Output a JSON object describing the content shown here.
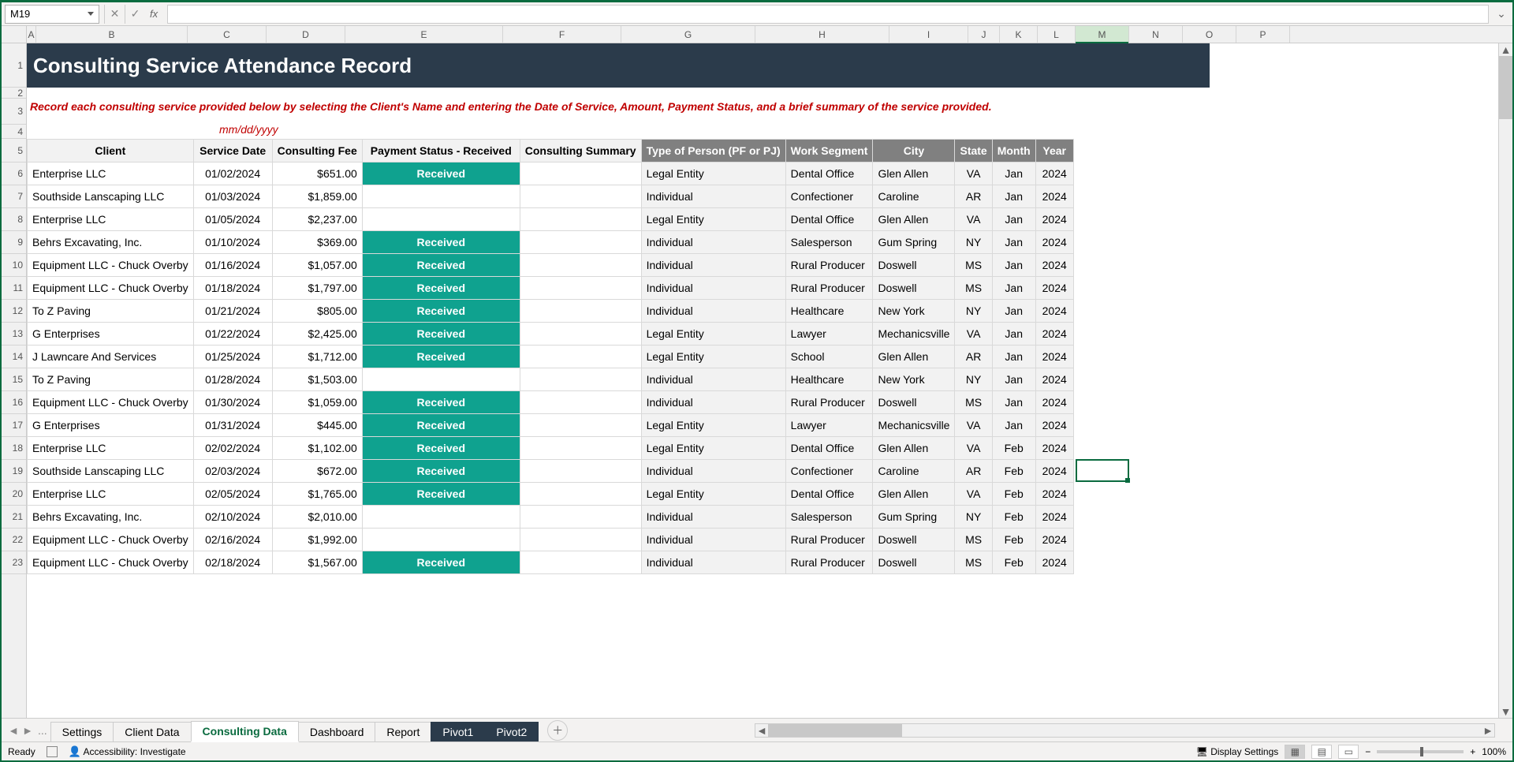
{
  "name_box": "M19",
  "fx_label": "fx",
  "title": "Consulting Service Attendance Record",
  "instruction": "Record each consulting service provided below by selecting the Client's Name and entering the Date of Service, Amount, Payment Status, and a brief summary of the service provided.",
  "date_format_hint": "mm/dd/yyyy",
  "columns": {
    "letters": [
      "A",
      "B",
      "C",
      "D",
      "E",
      "F",
      "G",
      "H",
      "I",
      "J",
      "K",
      "L",
      "M",
      "N",
      "O",
      "P"
    ],
    "active": "M"
  },
  "row_headers": [
    1,
    2,
    3,
    4,
    5,
    6,
    7,
    8,
    9,
    10,
    11,
    12,
    13,
    14,
    15,
    16,
    17,
    18,
    19,
    20,
    21,
    22,
    23
  ],
  "headers": {
    "client": "Client",
    "service_date": "Service Date",
    "fee": "Consulting Fee",
    "payment": "Payment Status - Received",
    "summary": "Consulting Summary",
    "type": "Type of Person (PF or PJ)",
    "segment": "Work Segment",
    "city": "City",
    "state": "State",
    "month": "Month",
    "year": "Year"
  },
  "rows": [
    {
      "client": "Enterprise LLC",
      "date": "01/02/2024",
      "fee": "$651.00",
      "received": true,
      "type": "Legal Entity",
      "segment": "Dental Office",
      "city": "Glen Allen",
      "state": "VA",
      "month": "Jan",
      "year": "2024"
    },
    {
      "client": "Southside Lanscaping LLC",
      "date": "01/03/2024",
      "fee": "$1,859.00",
      "received": false,
      "type": "Individual",
      "segment": "Confectioner",
      "city": "Caroline",
      "state": "AR",
      "month": "Jan",
      "year": "2024"
    },
    {
      "client": "Enterprise LLC",
      "date": "01/05/2024",
      "fee": "$2,237.00",
      "received": false,
      "type": "Legal Entity",
      "segment": "Dental Office",
      "city": "Glen Allen",
      "state": "VA",
      "month": "Jan",
      "year": "2024"
    },
    {
      "client": "Behrs Excavating, Inc.",
      "date": "01/10/2024",
      "fee": "$369.00",
      "received": true,
      "type": "Individual",
      "segment": "Salesperson",
      "city": "Gum Spring",
      "state": "NY",
      "month": "Jan",
      "year": "2024"
    },
    {
      "client": "Equipment LLC - Chuck Overby",
      "date": "01/16/2024",
      "fee": "$1,057.00",
      "received": true,
      "type": "Individual",
      "segment": "Rural Producer",
      "city": "Doswell",
      "state": "MS",
      "month": "Jan",
      "year": "2024"
    },
    {
      "client": "Equipment LLC - Chuck Overby",
      "date": "01/18/2024",
      "fee": "$1,797.00",
      "received": true,
      "type": "Individual",
      "segment": "Rural Producer",
      "city": "Doswell",
      "state": "MS",
      "month": "Jan",
      "year": "2024"
    },
    {
      "client": "To Z Paving",
      "date": "01/21/2024",
      "fee": "$805.00",
      "received": true,
      "type": "Individual",
      "segment": "Healthcare",
      "city": "New York",
      "state": "NY",
      "month": "Jan",
      "year": "2024"
    },
    {
      "client": "G Enterprises",
      "date": "01/22/2024",
      "fee": "$2,425.00",
      "received": true,
      "type": "Legal Entity",
      "segment": "Lawyer",
      "city": "Mechanicsville",
      "state": "VA",
      "month": "Jan",
      "year": "2024"
    },
    {
      "client": "J Lawncare And Services",
      "date": "01/25/2024",
      "fee": "$1,712.00",
      "received": true,
      "type": "Legal Entity",
      "segment": "School",
      "city": "Glen Allen",
      "state": "AR",
      "month": "Jan",
      "year": "2024"
    },
    {
      "client": "To Z Paving",
      "date": "01/28/2024",
      "fee": "$1,503.00",
      "received": false,
      "type": "Individual",
      "segment": "Healthcare",
      "city": "New York",
      "state": "NY",
      "month": "Jan",
      "year": "2024"
    },
    {
      "client": "Equipment LLC - Chuck Overby",
      "date": "01/30/2024",
      "fee": "$1,059.00",
      "received": true,
      "type": "Individual",
      "segment": "Rural Producer",
      "city": "Doswell",
      "state": "MS",
      "month": "Jan",
      "year": "2024"
    },
    {
      "client": "G Enterprises",
      "date": "01/31/2024",
      "fee": "$445.00",
      "received": true,
      "type": "Legal Entity",
      "segment": "Lawyer",
      "city": "Mechanicsville",
      "state": "VA",
      "month": "Jan",
      "year": "2024"
    },
    {
      "client": "Enterprise LLC",
      "date": "02/02/2024",
      "fee": "$1,102.00",
      "received": true,
      "type": "Legal Entity",
      "segment": "Dental Office",
      "city": "Glen Allen",
      "state": "VA",
      "month": "Feb",
      "year": "2024"
    },
    {
      "client": "Southside Lanscaping LLC",
      "date": "02/03/2024",
      "fee": "$672.00",
      "received": true,
      "type": "Individual",
      "segment": "Confectioner",
      "city": "Caroline",
      "state": "AR",
      "month": "Feb",
      "year": "2024"
    },
    {
      "client": "Enterprise LLC",
      "date": "02/05/2024",
      "fee": "$1,765.00",
      "received": true,
      "type": "Legal Entity",
      "segment": "Dental Office",
      "city": "Glen Allen",
      "state": "VA",
      "month": "Feb",
      "year": "2024"
    },
    {
      "client": "Behrs Excavating, Inc.",
      "date": "02/10/2024",
      "fee": "$2,010.00",
      "received": false,
      "type": "Individual",
      "segment": "Salesperson",
      "city": "Gum Spring",
      "state": "NY",
      "month": "Feb",
      "year": "2024"
    },
    {
      "client": "Equipment LLC - Chuck Overby",
      "date": "02/16/2024",
      "fee": "$1,992.00",
      "received": false,
      "type": "Individual",
      "segment": "Rural Producer",
      "city": "Doswell",
      "state": "MS",
      "month": "Feb",
      "year": "2024"
    },
    {
      "client": "Equipment LLC - Chuck Overby",
      "date": "02/18/2024",
      "fee": "$1,567.00",
      "received": true,
      "type": "Individual",
      "segment": "Rural Producer",
      "city": "Doswell",
      "state": "MS",
      "month": "Feb",
      "year": "2024"
    }
  ],
  "received_label": "Received",
  "tabs": {
    "items": [
      {
        "label": "Settings",
        "style": "normal"
      },
      {
        "label": "Client Data",
        "style": "normal"
      },
      {
        "label": "Consulting Data",
        "style": "active"
      },
      {
        "label": "Dashboard",
        "style": "normal"
      },
      {
        "label": "Report",
        "style": "normal"
      },
      {
        "label": "Pivot1",
        "style": "dark"
      },
      {
        "label": "Pivot2",
        "style": "dark"
      }
    ]
  },
  "status": {
    "ready": "Ready",
    "accessibility": "Accessibility: Investigate",
    "display_settings": "Display Settings",
    "zoom": "100%"
  }
}
